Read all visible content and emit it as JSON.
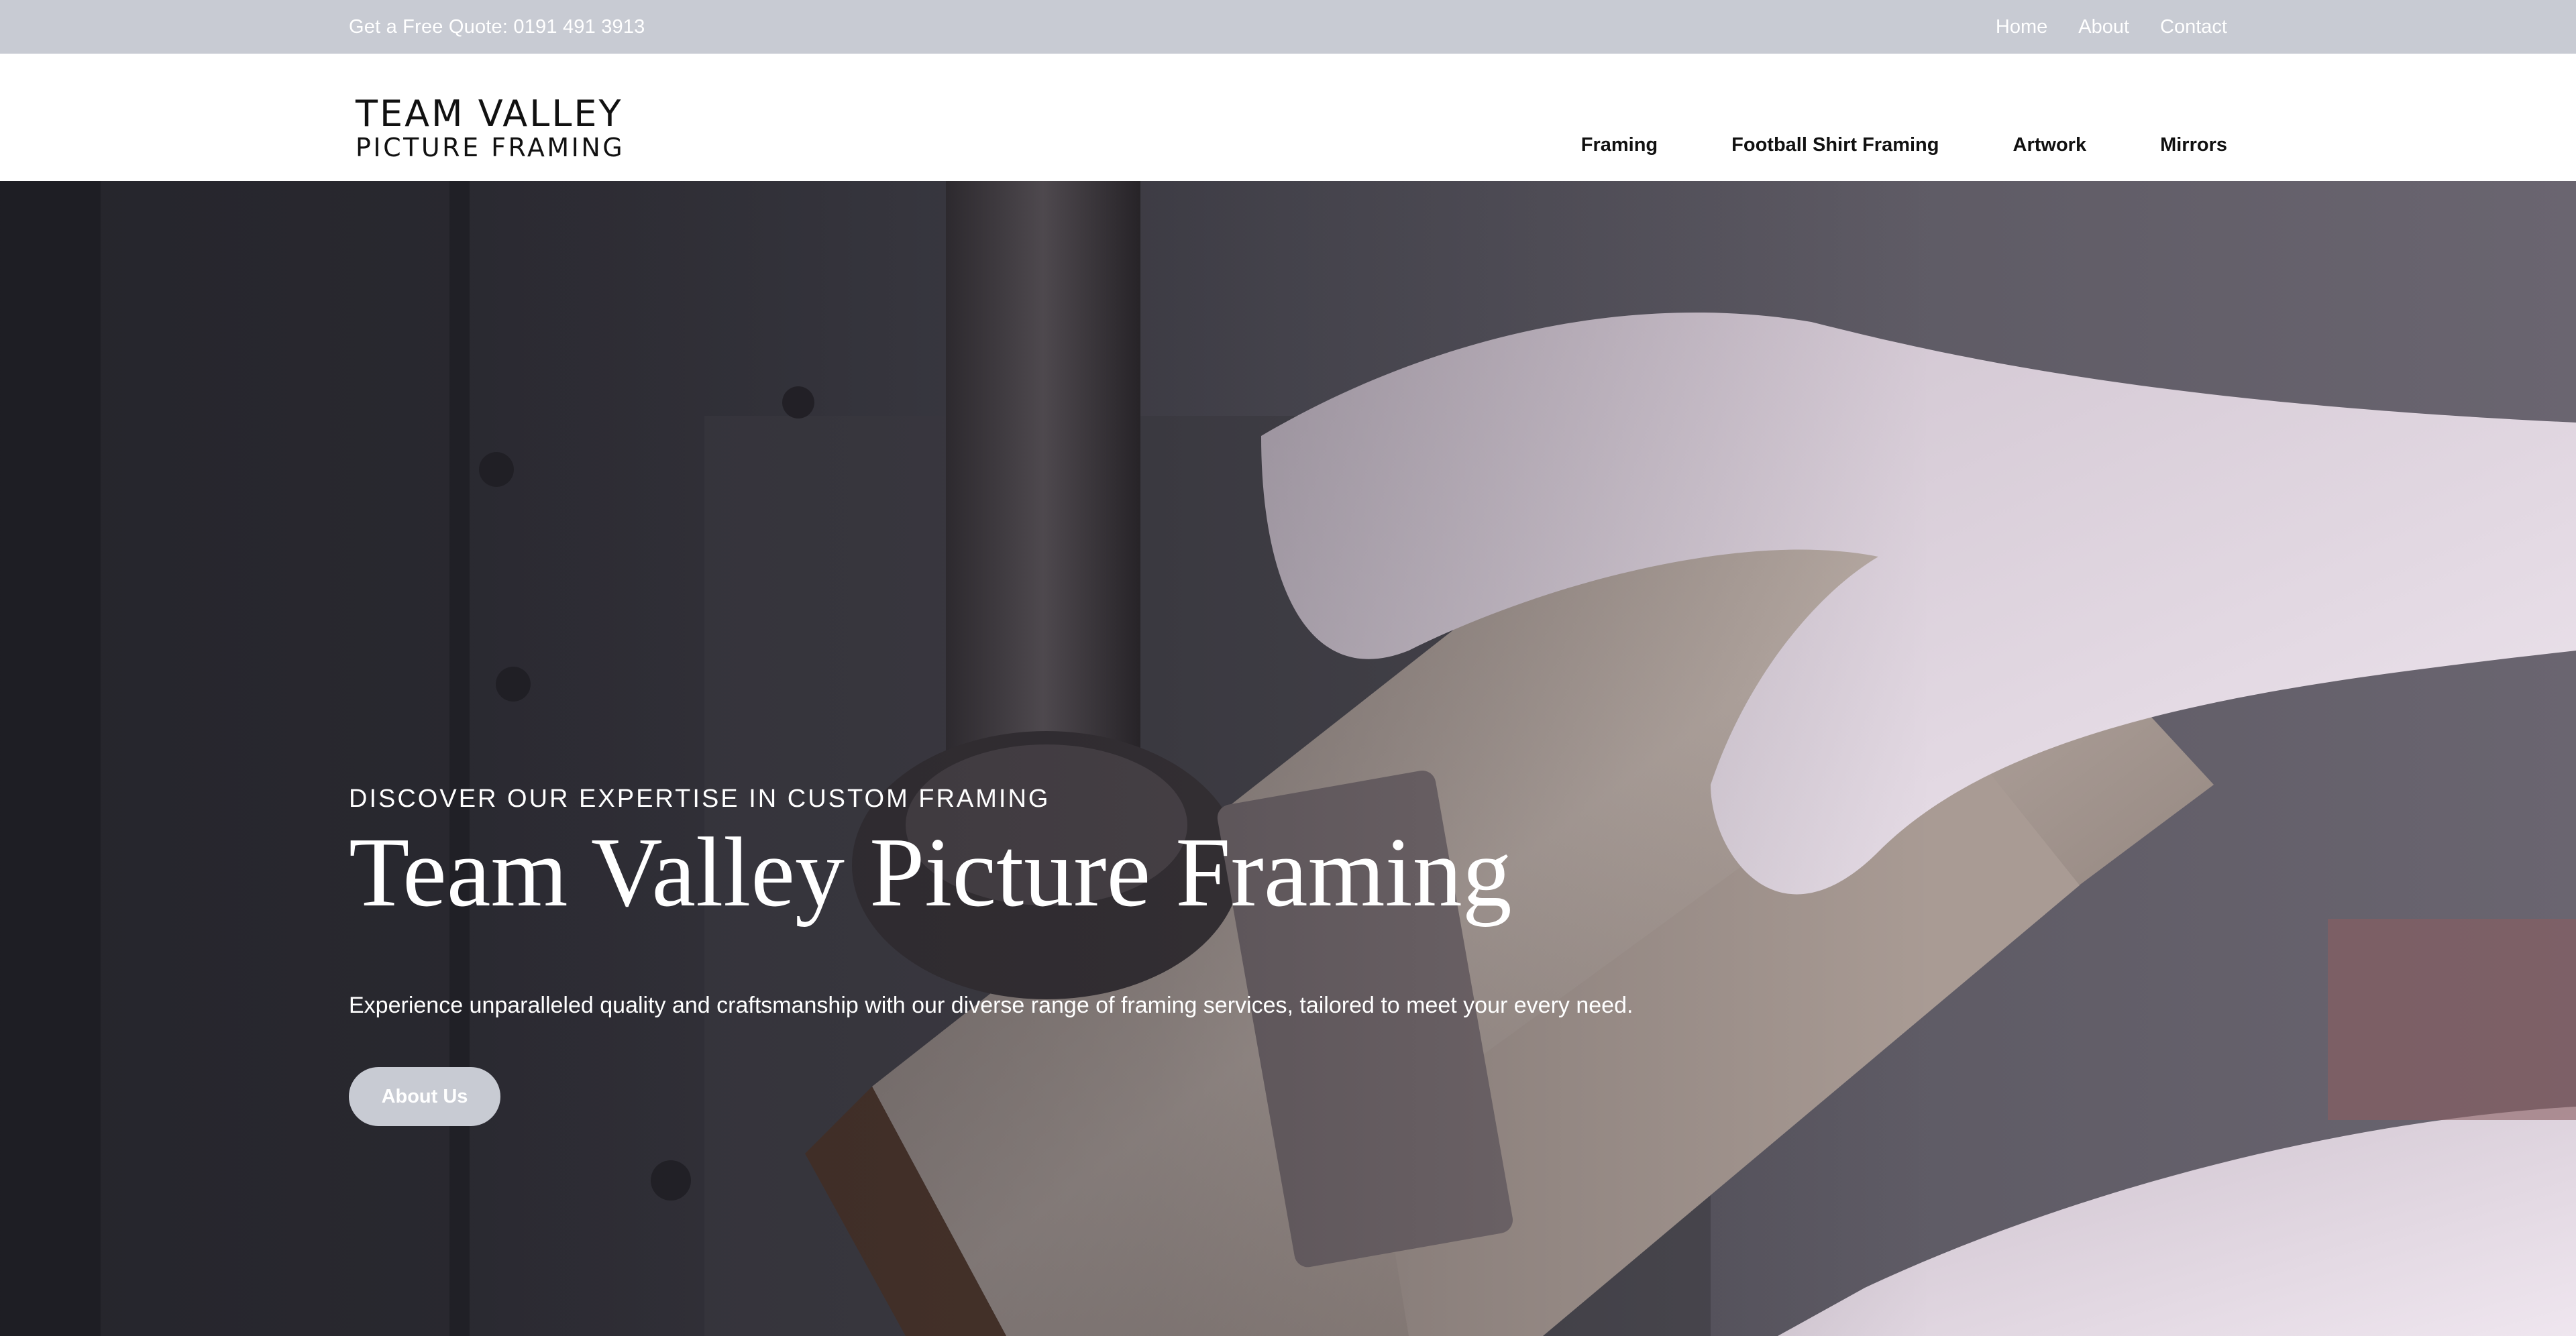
{
  "topbar": {
    "quote": "Get a Free Quote: 0191 491 3913",
    "links": [
      "Home",
      "About",
      "Contact"
    ]
  },
  "header": {
    "logo_line1": "TEAM VALLEY",
    "logo_line2": "PICTURE FRAMING",
    "nav": [
      "Framing",
      "Football Shirt Framing",
      "Artwork",
      "Mirrors"
    ]
  },
  "hero": {
    "eyebrow": "DISCOVER OUR EXPERTISE IN CUSTOM FRAMING",
    "title": "Team Valley Picture Framing",
    "subtitle": "Experience unparalleled quality and craftsmanship with our diverse range of framing services, tailored to meet your every need.",
    "button": "About Us"
  },
  "colors": {
    "topbar_bg": "#c8cbd3",
    "button_bg": "#c8cbd3",
    "text_dark": "#111111",
    "text_light": "#ffffff"
  }
}
